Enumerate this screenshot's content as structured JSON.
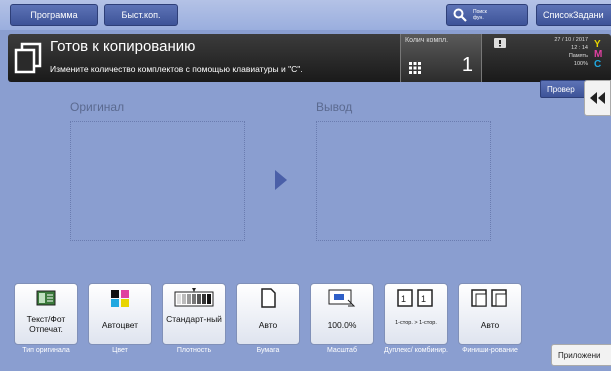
{
  "topbar": {
    "program_label": "Программа",
    "fast_label": "Быст.коп.",
    "search_label_1": "Поиск",
    "search_label_2": "фун.",
    "joblist_label": "СписокЗадани"
  },
  "status": {
    "title": "Готов к копированию",
    "message": "Измените количество комплектов с помощью клавиатуры и \"C\".",
    "copies_label": "Колич компл.",
    "copies_value": "1",
    "date": "27 / 10 / 2017",
    "time": "12 : 14",
    "memory_label": "Память",
    "memory_value": "100%",
    "toner_letters": [
      "Y",
      "M",
      "C"
    ]
  },
  "check_label": "Провер",
  "preview": {
    "original_label": "Оригинал",
    "output_label": "Вывод"
  },
  "function_keys": [
    {
      "value": "Текст/Фот Отпечат.",
      "label": "Тип оригинала",
      "icon": "text-photo-icon"
    },
    {
      "value": "Автоцвет",
      "label": "Цвет",
      "icon": "color-icon"
    },
    {
      "value": "Стандарт-ный",
      "label": "Плотность",
      "icon": "density-icon"
    },
    {
      "value": "Авто",
      "label": "Бумага",
      "icon": "paper-icon"
    },
    {
      "value": "100.0%",
      "label": "Масштаб",
      "icon": "zoom-icon"
    },
    {
      "value": "1-стор. > 1-стор.",
      "label": "Дуплекс/ комбинир.",
      "icon": "duplex-icon"
    },
    {
      "value": "Авто",
      "label": "Финиши-рование",
      "icon": "finishing-icon"
    }
  ],
  "apps_label": "Приложени",
  "colors": {
    "background": "#8a9ed0",
    "button_blue": "#3d5398",
    "status_bar": "#1a1a1a"
  }
}
